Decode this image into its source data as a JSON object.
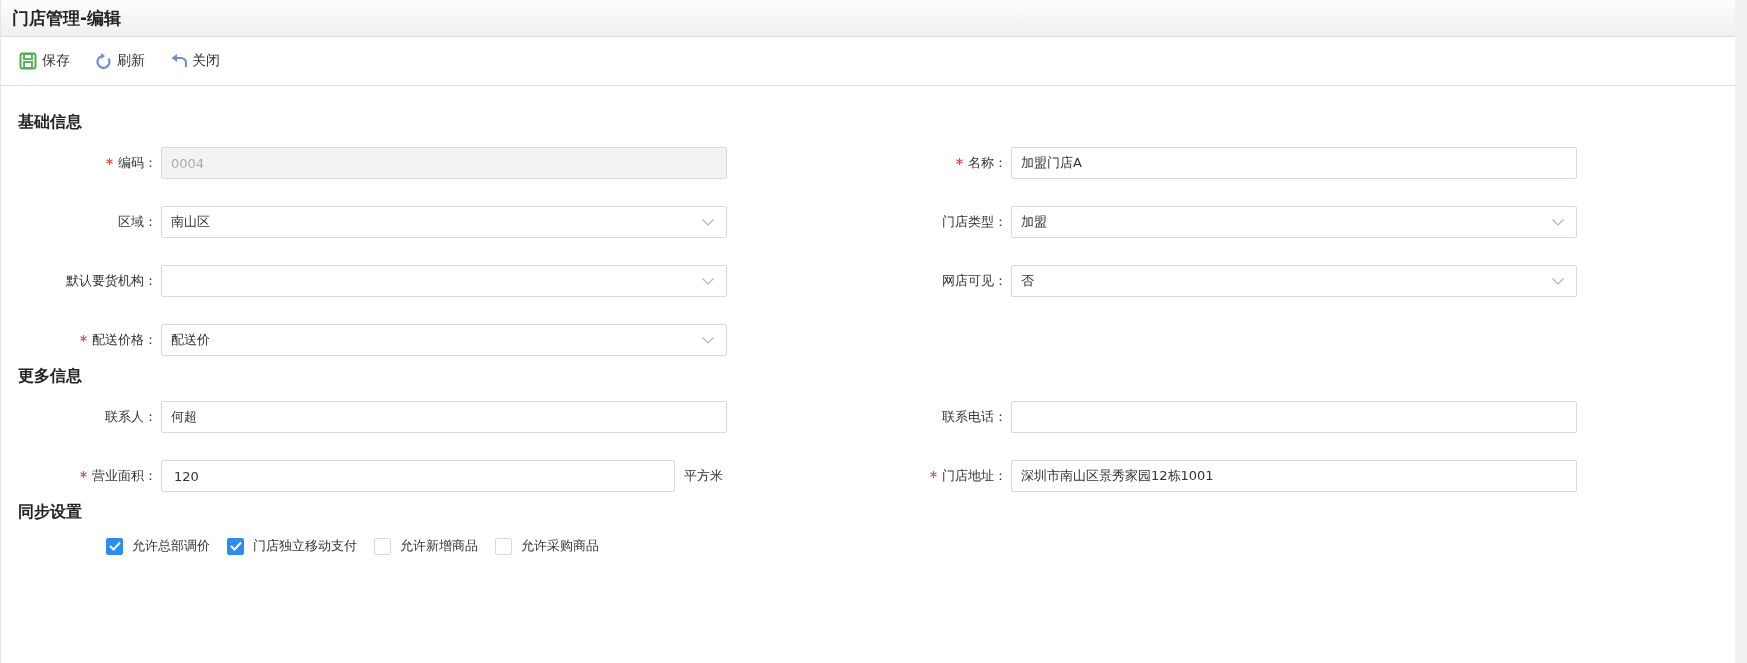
{
  "window": {
    "title": "门店管理-编辑"
  },
  "toolbar": [
    {
      "kind": "save",
      "label": "保存"
    },
    {
      "kind": "refresh",
      "label": "刷新"
    },
    {
      "kind": "close",
      "label": "关闭"
    }
  ],
  "sections": [
    {
      "title": "基础信息",
      "fields": [
        {
          "label": "编码：",
          "required": true,
          "kind": "readonly",
          "value": "0004"
        },
        {
          "label": "名称：",
          "required": true,
          "kind": "text",
          "value": "加盟门店A"
        },
        {
          "label": "区域：",
          "required": false,
          "kind": "select",
          "value": "南山区"
        },
        {
          "label": "门店类型：",
          "required": false,
          "kind": "select",
          "value": "加盟"
        },
        {
          "label": "默认要货机构：",
          "required": false,
          "kind": "select"
        },
        {
          "label": "网店可见：",
          "required": false,
          "kind": "select",
          "value": "否"
        },
        {
          "label": "配送价格：",
          "required": true,
          "kind": "select",
          "value": "配送价"
        }
      ]
    },
    {
      "title": "更多信息",
      "fields": [
        {
          "label": "联系人：",
          "required": false,
          "kind": "text",
          "value": "何超"
        },
        {
          "label": "联系电话：",
          "required": false,
          "kind": "text"
        },
        {
          "label": "营业面积：",
          "required": true,
          "kind": "text",
          "value": "120",
          "unit": "平方米"
        },
        {
          "label": "门店地址：",
          "required": true,
          "kind": "text",
          "value": "深圳市南山区景秀家园12栋1001"
        }
      ]
    }
  ],
  "sync": {
    "title": "同步设置",
    "options": [
      {
        "label": "允许总部调价",
        "checked": true
      },
      {
        "label": "门店独立移动支付",
        "checked": true
      },
      {
        "label": "允许新增商品",
        "checked": false
      },
      {
        "label": "允许采购商品",
        "checked": false
      }
    ]
  }
}
